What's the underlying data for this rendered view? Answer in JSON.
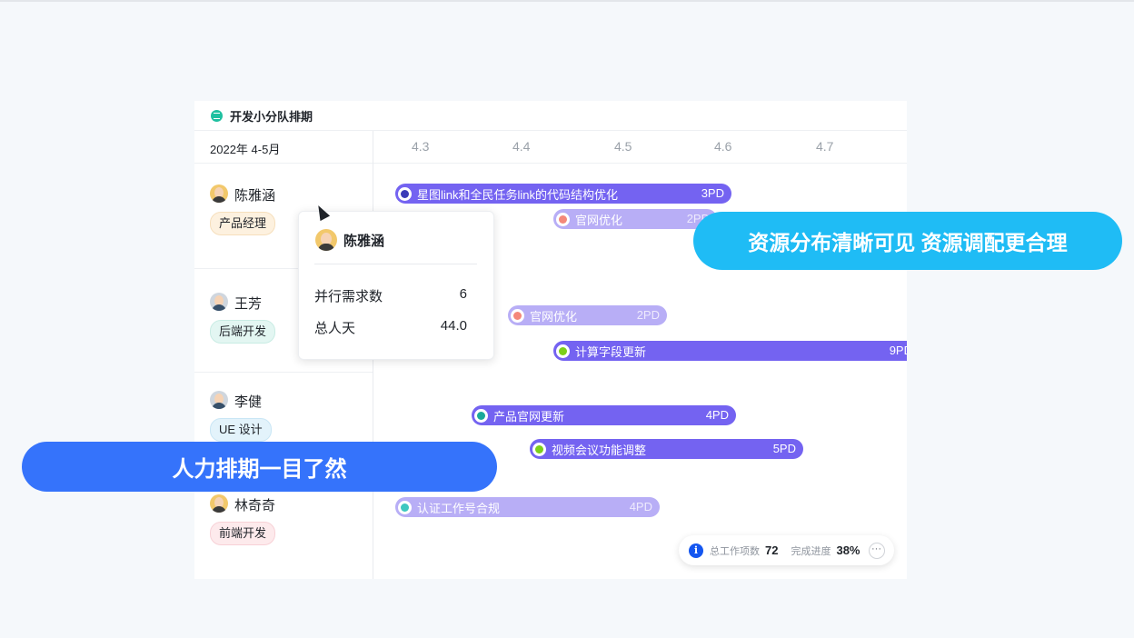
{
  "board": {
    "title": "开发小分队排期",
    "period": "2022年 4-5月"
  },
  "timeline": {
    "dates": [
      "4.3",
      "4.4",
      "4.5",
      "4.6",
      "4.7"
    ]
  },
  "people": [
    {
      "name": "陈雅涵",
      "role": "产品经理"
    },
    {
      "name": "王芳",
      "role": "后端开发"
    },
    {
      "name": "李健",
      "role": "UE 设计"
    },
    {
      "name": "林奇奇",
      "role": "前端开发"
    }
  ],
  "tasks": [
    {
      "label": "星图link和全民任务link的代码结构优化",
      "effort": "3PD",
      "style": "dark",
      "dot_color": "#3a3ab8"
    },
    {
      "label": "官网优化",
      "effort": "2PD",
      "style": "light",
      "dot_color": "#f4887a"
    },
    {
      "label": "官网优化",
      "effort": "2PD",
      "style": "light",
      "dot_color": "#f4887a"
    },
    {
      "label": "计算字段更新",
      "effort": "9PD",
      "style": "dark",
      "dot_color": "#7ccf1a"
    },
    {
      "label": "产品官网更新",
      "effort": "4PD",
      "style": "dark",
      "dot_color": "#1aa99a"
    },
    {
      "label": "视频会议功能调整",
      "effort": "5PD",
      "style": "dark",
      "dot_color": "#7ccf1a"
    },
    {
      "label": "认证工作号合规",
      "effort": "4PD",
      "style": "light",
      "dot_color": "#3dc7c0"
    }
  ],
  "popover": {
    "name": "陈雅涵",
    "rows": [
      {
        "label": "并行需求数",
        "value": "6"
      },
      {
        "label": "总人天",
        "value": "44.0"
      }
    ]
  },
  "summary": {
    "info_icon": "info-icon",
    "total_label": "总工作项数",
    "total_value": "72",
    "progress_label": "完成进度",
    "progress_value": "38%",
    "more_icon": "···"
  },
  "banners": {
    "right": "资源分布清晰可见 资源调配更合理",
    "left": "人力排期一目了然"
  },
  "colors": {
    "bar_dark": "#7463f1",
    "bar_light": "#b8aef6",
    "banner_right": "#1fbcf5",
    "banner_left": "#3573fb"
  }
}
